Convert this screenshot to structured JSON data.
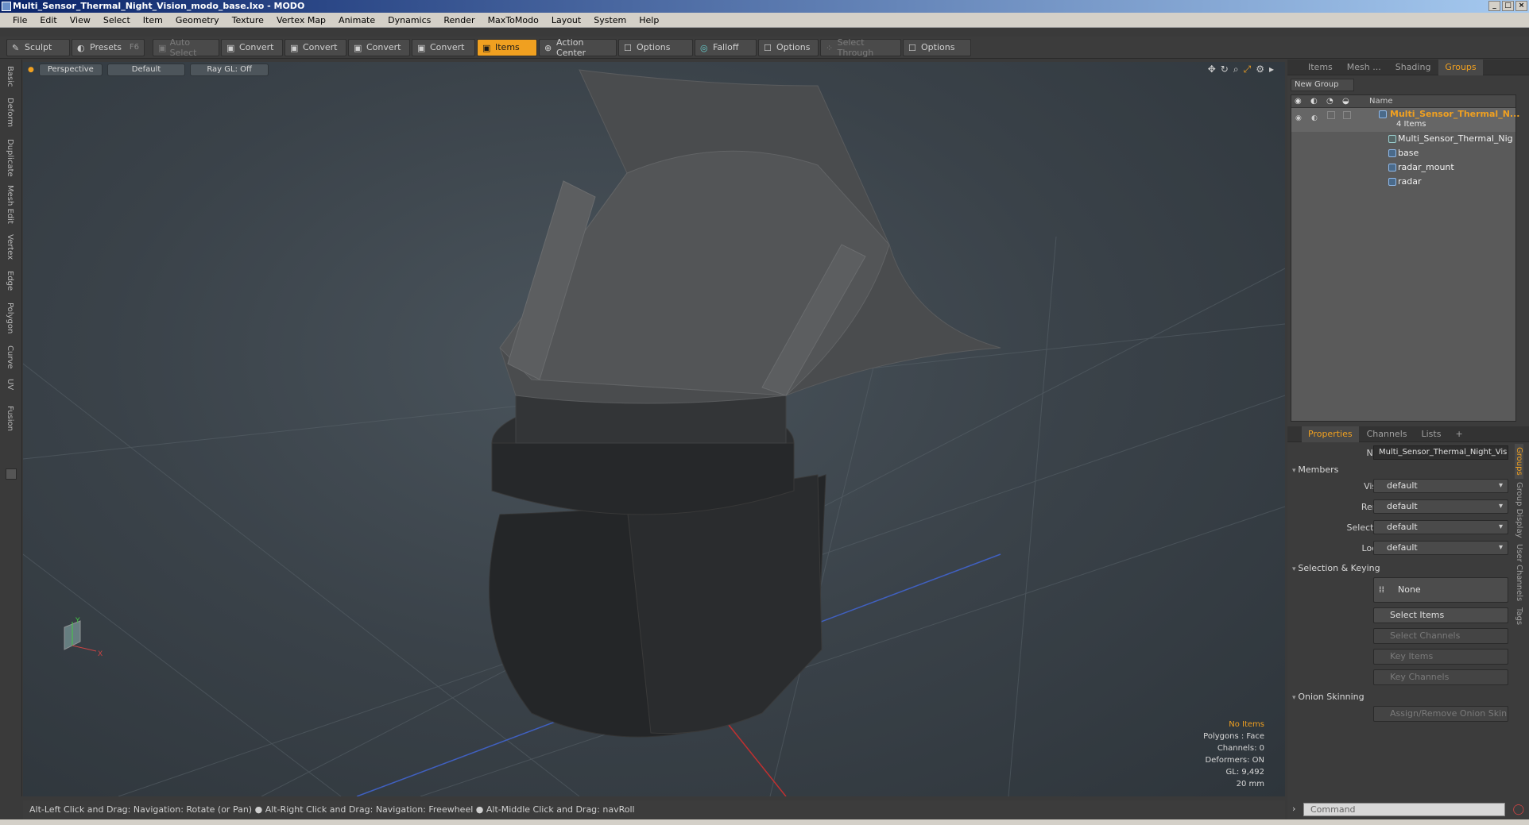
{
  "window": {
    "title": "Multi_Sensor_Thermal_Night_Vision_modo_base.lxo - MODO"
  },
  "menu": [
    "File",
    "Edit",
    "View",
    "Select",
    "Item",
    "Geometry",
    "Texture",
    "Vertex Map",
    "Animate",
    "Dynamics",
    "Render",
    "MaxToModo",
    "Layout",
    "System",
    "Help"
  ],
  "toolbar": {
    "sculpt": "Sculpt",
    "presets": "Presets",
    "presets_key": "F6",
    "auto_select": "Auto Select",
    "convert1": "Convert",
    "convert2": "Convert",
    "convert3": "Convert",
    "convert4": "Convert",
    "items": "Items",
    "action_center": "Action Center",
    "options1": "Options",
    "falloff": "Falloff",
    "options2": "Options",
    "select_through": "Select Through",
    "options3": "Options"
  },
  "left_tabs": [
    "Basic",
    "Deform",
    "Duplicate",
    "Mesh Edit",
    "Vertex",
    "Edge",
    "Polygon",
    "Curve",
    "UV",
    "Fusion"
  ],
  "viewport": {
    "view": "Perspective",
    "shading": "Default",
    "raygl": "Ray GL: Off",
    "info": {
      "items": "No Items",
      "polygons": "Polygons : Face",
      "channels": "Channels: 0",
      "deformers": "Deformers: ON",
      "gl": "GL: 9,492",
      "scale": "20 mm"
    }
  },
  "status": "Alt-Left Click and Drag: Navigation: Rotate (or Pan) ● Alt-Right Click and Drag: Navigation: Freewheel ● Alt-Middle Click and Drag: navRoll",
  "right_tabs": [
    "Items",
    "Mesh ...",
    "Shading",
    "Groups"
  ],
  "groups": {
    "new_group": "New Group",
    "col_name": "Name",
    "group_name": "Multi_Sensor_Thermal_N...",
    "group_count": "4 Items",
    "children": [
      "Multi_Sensor_Thermal_Nig ...",
      "base",
      "radar_mount",
      "radar"
    ]
  },
  "props_tabs": [
    "Properties",
    "Channels",
    "Lists",
    "+"
  ],
  "properties": {
    "name_label": "Name",
    "name_value": "Multi_Sensor_Thermal_Night_Visi",
    "members": "Members",
    "visible_label": "Visible",
    "visible": "default",
    "render_label": "Render",
    "render": "default",
    "selectable_label": "Selectable",
    "selectable": "default",
    "locked_label": "Locked",
    "locked": "default",
    "selection_keying": "Selection & Keying",
    "none": "None",
    "select_items": "Select Items",
    "select_channels": "Select Channels",
    "key_items": "Key Items",
    "key_channels": "Key Channels",
    "onion": "Onion Skinning",
    "assign_onion": "Assign/Remove Onion Skin"
  },
  "side_tabs": [
    "Groups",
    "Group Display",
    "User Channels",
    "Tags"
  ],
  "command": {
    "placeholder": "Command"
  }
}
